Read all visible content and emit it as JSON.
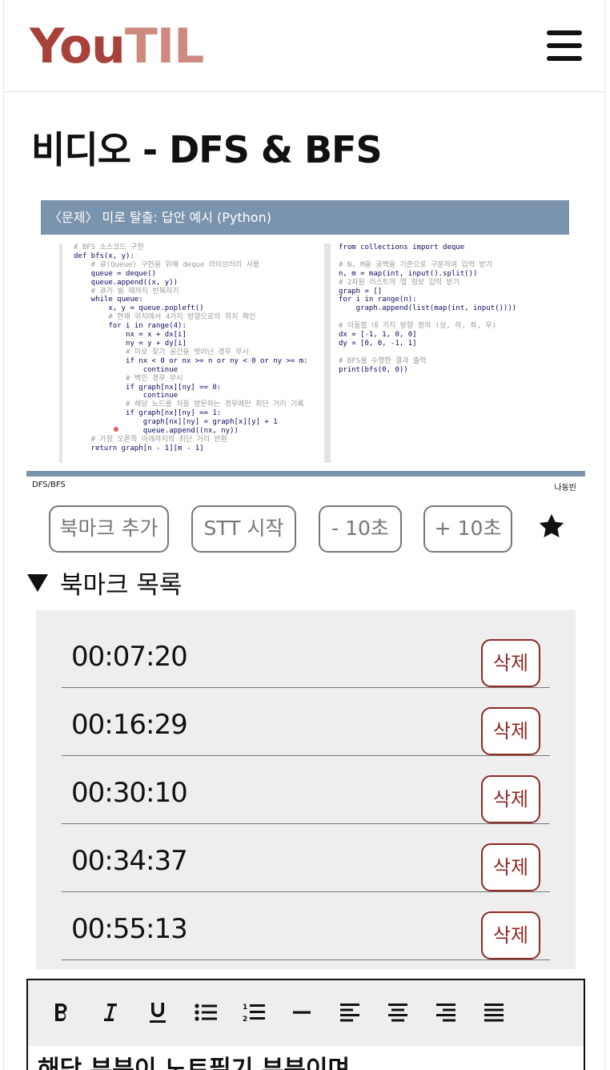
{
  "header": {
    "logo_part1": "You",
    "logo_part2": "TIL",
    "logo_color1": "#a8413a",
    "logo_color2": "#cf8a80",
    "menu_icon": "hamburger-menu-icon"
  },
  "page": {
    "title": "비디오 - DFS & BFS"
  },
  "video": {
    "slide_title": "〈문제〉 미로 탈출: 답안 예시 (Python)",
    "code_left": [
      {
        "t": "# BFS 소스코드 구현",
        "c": true
      },
      {
        "t": "def bfs(x, y):",
        "c": false
      },
      {
        "t": "    # 큐(Queue) 구현을 위해 deque 라이브러리 사용",
        "c": true
      },
      {
        "t": "    queue = deque()",
        "c": false
      },
      {
        "t": "    queue.append((x, y))",
        "c": false
      },
      {
        "t": "    # 큐가 빌 때까지 반복하기",
        "c": true
      },
      {
        "t": "    while queue:",
        "c": false
      },
      {
        "t": "        x, y = queue.popleft()",
        "c": false
      },
      {
        "t": "        # 현재 위치에서 4가지 방향으로의 위치 확인",
        "c": true
      },
      {
        "t": "        for i in range(4):",
        "c": false
      },
      {
        "t": "            nx = x + dx[i]",
        "c": false
      },
      {
        "t": "            ny = y + dy[i]",
        "c": false
      },
      {
        "t": "            # 미로 찾기 공간을 벗어난 경우 무시",
        "c": true
      },
      {
        "t": "            if nx < 0 or nx >= n or ny < 0 or ny >= m:",
        "c": false
      },
      {
        "t": "                continue",
        "c": false
      },
      {
        "t": "            # 벽인 경우 무시",
        "c": true
      },
      {
        "t": "            if graph[nx][ny] == 0:",
        "c": false
      },
      {
        "t": "                continue",
        "c": false
      },
      {
        "t": "            # 해당 노드를 처음 방문하는 경우에만 최단 거리 기록",
        "c": true
      },
      {
        "t": "            if graph[nx][ny] == 1:",
        "c": false
      },
      {
        "t": "                graph[nx][ny] = graph[x][y] + 1",
        "c": false
      },
      {
        "t": "                queue.append((nx, ny))",
        "c": false
      },
      {
        "t": "    # 가장 오른쪽 아래까지의 최단 거리 반환",
        "c": true
      },
      {
        "t": "    return graph[n - 1][m - 1]",
        "c": false
      }
    ],
    "code_right": [
      {
        "t": "from collections import deque",
        "c": false
      },
      {
        "t": "",
        "c": false
      },
      {
        "t": "# N, M을 공백을 기준으로 구분하여 입력 받기",
        "c": true
      },
      {
        "t": "n, m = map(int, input().split())",
        "c": false
      },
      {
        "t": "# 2차원 리스트의 맵 정보 입력 받기",
        "c": true
      },
      {
        "t": "graph = []",
        "c": false
      },
      {
        "t": "for i in range(n):",
        "c": false
      },
      {
        "t": "    graph.append(list(map(int, input())))",
        "c": false
      },
      {
        "t": "",
        "c": false
      },
      {
        "t": "# 이동할 네 가지 방향 정의 (상, 하, 좌, 우)",
        "c": true
      },
      {
        "t": "dx = [-1, 1, 0, 0]",
        "c": false
      },
      {
        "t": "dy = [0, 0, -1, 1]",
        "c": false
      },
      {
        "t": "",
        "c": false
      },
      {
        "t": "# BFS를 수행한 결과 출력",
        "c": true
      },
      {
        "t": "print(bfs(0, 0))",
        "c": false
      }
    ],
    "footer_left": "DFS/BFS",
    "footer_right": "나동빈",
    "accent_color": "#7b94ad"
  },
  "controls": {
    "bookmark_add": "북마크 추가",
    "stt_start": "STT 시작",
    "minus_10": "- 10초",
    "plus_10": "+ 10초",
    "star_icon": "star-icon"
  },
  "bookmarks": {
    "title": "북마크 목록",
    "toggle_icon": "triangle-down-icon",
    "delete_label": "삭제",
    "delete_color": "#8c2a24",
    "items": [
      {
        "time": "00:07:20",
        "delete": "삭제"
      },
      {
        "time": "00:16:29",
        "delete": "삭제"
      },
      {
        "time": "00:30:10",
        "delete": "삭제"
      },
      {
        "time": "00:34:37",
        "delete": "삭제"
      },
      {
        "time": "00:55:13",
        "delete": "삭제"
      }
    ]
  },
  "editor": {
    "toolbar": [
      "bold-icon",
      "italic-icon",
      "underline-icon",
      "bullet-list-icon",
      "numbered-list-icon",
      "horizontal-rule-icon",
      "align-left-icon",
      "align-center-icon",
      "align-right-icon",
      "align-justify-icon"
    ],
    "content": "해당 부분이 노트필기 부분이며"
  }
}
